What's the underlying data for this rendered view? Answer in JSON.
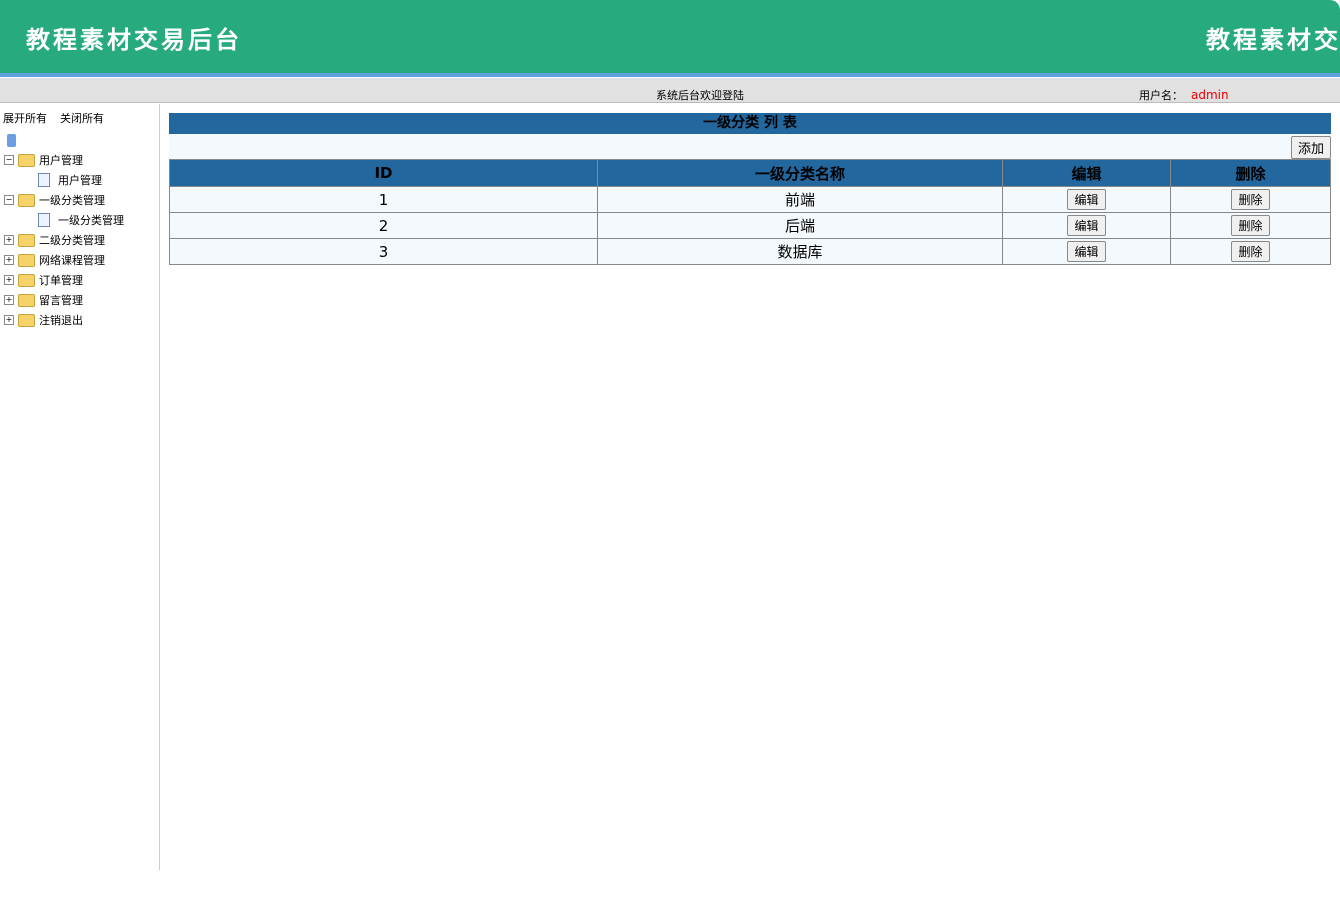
{
  "header": {
    "title": "教程素材交易后台",
    "marquee_title": "教程素材交易后台"
  },
  "topbar": {
    "welcome": "系统后台欢迎登陆",
    "user_label": "用户名：",
    "user_name": "admin"
  },
  "sidebar": {
    "expand_all": "展开所有",
    "collapse_all": "关闭所有",
    "items": [
      {
        "label": "用户管理",
        "expanded": true,
        "child": "用户管理"
      },
      {
        "label": "一级分类管理",
        "expanded": true,
        "child": "一级分类管理"
      },
      {
        "label": "二级分类管理"
      },
      {
        "label": "网络课程管理"
      },
      {
        "label": "订单管理"
      },
      {
        "label": "留言管理"
      },
      {
        "label": "注销退出"
      }
    ]
  },
  "main": {
    "title": "一级分类 列 表",
    "add_label": "添加",
    "columns": [
      "ID",
      "一级分类名称",
      "编辑",
      "删除"
    ],
    "rows": [
      {
        "id": "1",
        "name": "前端"
      },
      {
        "id": "2",
        "name": "后端"
      },
      {
        "id": "3",
        "name": "数据库"
      }
    ],
    "edit_label": "编辑",
    "delete_label": "删除"
  },
  "colors": {
    "header": "#27ab7e",
    "table_header": "#23679f",
    "username": "#e00000"
  }
}
